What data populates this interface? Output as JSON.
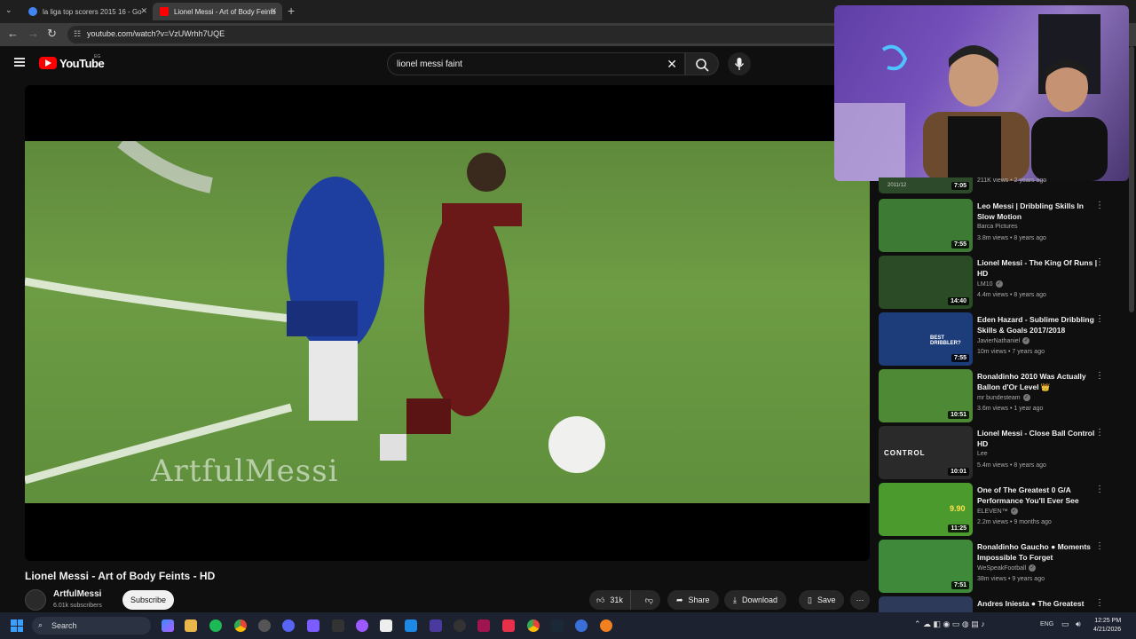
{
  "browser": {
    "tabs": [
      {
        "label": "la liga top scorers 2015 16 - Go",
        "favicon_color": "#4285f4"
      },
      {
        "label": "Lionel Messi - Art of Body Feints",
        "favicon_color": "#ff0000"
      }
    ],
    "new_tab": "+",
    "url": "youtube.com/watch?v=VzUWrhh7UQE"
  },
  "header": {
    "brand": "YouTube",
    "country": "EG",
    "search_value": "lionel messi faint"
  },
  "video": {
    "watermark": "ArtfulMessi",
    "title": "Lionel Messi - Art of Body Feints - HD",
    "channel": "ArtfulMessi",
    "subscribers": "6.01k subscribers",
    "subscribe_label": "Subscribe",
    "likes": "31k",
    "share_label": "Share",
    "download_label": "Download",
    "save_label": "Save"
  },
  "sidebar": {
    "partial_top": {
      "duration": "7:05",
      "meta": "211K views • 2 years ago",
      "caption": "2011/12"
    },
    "items": [
      {
        "title": "Leo Messi | Dribbling Skills In Slow Motion",
        "channel": "Barca Pictures",
        "verified": false,
        "meta": "3.8m views • 8 years ago",
        "duration": "7:55",
        "thumb_color": "#3d7a33"
      },
      {
        "title": "Lionel Messi - The King Of Runs | HD",
        "channel": "LM10",
        "verified": true,
        "meta": "4.4m views • 8 years ago",
        "duration": "14:40",
        "thumb_color": "#2b4a26"
      },
      {
        "title": "Eden Hazard - Sublime Dribbling Skills & Goals 2017/2018",
        "channel": "JavierNathaniel",
        "verified": true,
        "meta": "10m views • 7 years ago",
        "duration": "7:55",
        "thumb_color": "#1d3d7a",
        "thumb_text": "BEST DRIBBLER?"
      },
      {
        "title": "Ronaldinho 2010 Was Actually Ballon d'Or Level 👑",
        "channel": "mr bundesteam",
        "verified": true,
        "meta": "3.6m views • 1 year ago",
        "duration": "10:51",
        "thumb_color": "#4e8a35"
      },
      {
        "title": "Lionel Messi - Close Ball Control HD",
        "channel": "Lee",
        "verified": false,
        "meta": "5.4m views • 8 years ago",
        "duration": "10:01",
        "thumb_color": "#2a2a2a",
        "thumb_text": "CONTROL"
      },
      {
        "title": "One of The Greatest 0 G/A Performance You'll Ever See",
        "channel": "ELEVEN™",
        "verified": true,
        "meta": "2.2m views • 9 months ago",
        "duration": "11:25",
        "thumb_color": "#4a9a2e",
        "thumb_text": "9.90"
      },
      {
        "title": "Ronaldinho Gaucho ● Moments Impossible To Forget",
        "channel": "WeSpeakFootball",
        "verified": true,
        "meta": "38m views • 9 years ago",
        "duration": "7:51",
        "thumb_color": "#3f8a3a"
      },
      {
        "title": "Andres Iniesta ● The Greatest",
        "channel": "",
        "verified": false,
        "meta": "",
        "duration": "",
        "thumb_color": "#2e3a5a"
      }
    ]
  },
  "taskbar": {
    "search_label": "Search",
    "language": "ENG",
    "time": "12:25 PM",
    "date": "4/21/2026"
  }
}
